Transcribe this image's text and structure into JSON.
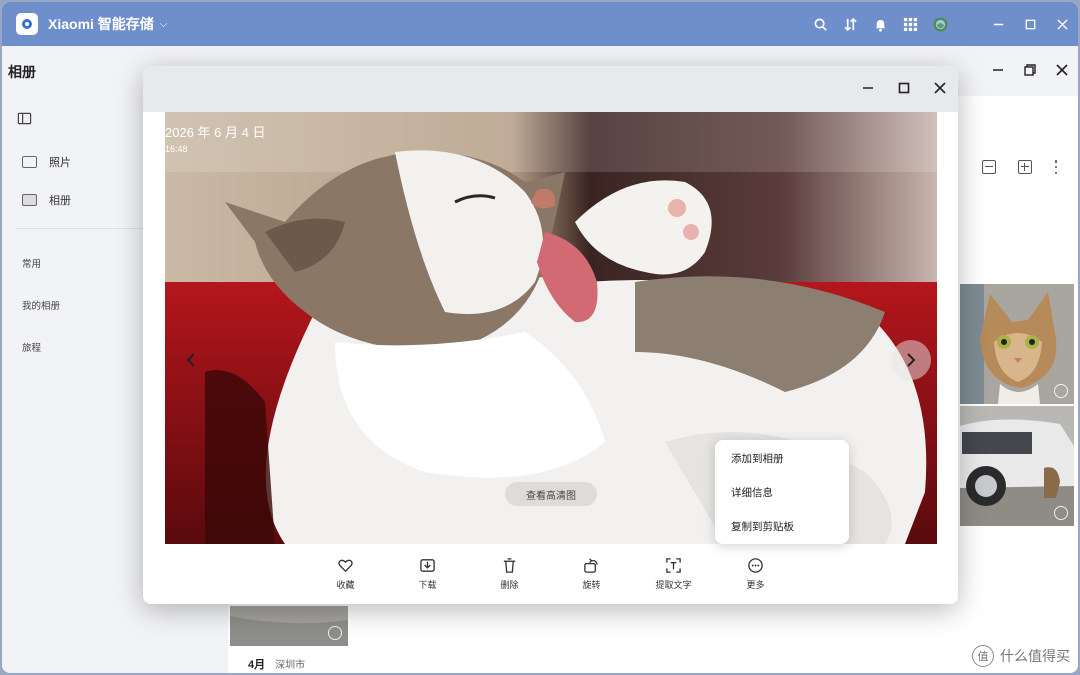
{
  "app": {
    "title": "Xiaomi 智能存储"
  },
  "page": {
    "title": "相册"
  },
  "sidebar": {
    "items": [
      {
        "label": "照片",
        "icon": "photo-icon"
      },
      {
        "label": "相册",
        "icon": "album-icon"
      }
    ],
    "sections": [
      {
        "label": "常用"
      },
      {
        "label": "我的相册"
      },
      {
        "label": "旅程"
      }
    ]
  },
  "content": {
    "date_row": {
      "month": "4月",
      "city": "深圳市"
    }
  },
  "viewer": {
    "date": "2026 年 6 月 4 日",
    "time": "16:48",
    "hd_button": "查看高清图",
    "menu": [
      "添加到相册",
      "详细信息",
      "复制到剪贴板"
    ],
    "toolbar": [
      {
        "label": "收藏",
        "icon": "heart-icon"
      },
      {
        "label": "下载",
        "icon": "download-icon"
      },
      {
        "label": "删除",
        "icon": "trash-icon"
      },
      {
        "label": "旋转",
        "icon": "rotate-icon"
      },
      {
        "label": "提取文字",
        "icon": "scan-text-icon"
      },
      {
        "label": "更多",
        "icon": "more-icon"
      }
    ]
  },
  "watermark": {
    "text": "什么值得买"
  },
  "colors": {
    "titlebar": "#6f8fca",
    "accent": "#3b6fd6"
  }
}
